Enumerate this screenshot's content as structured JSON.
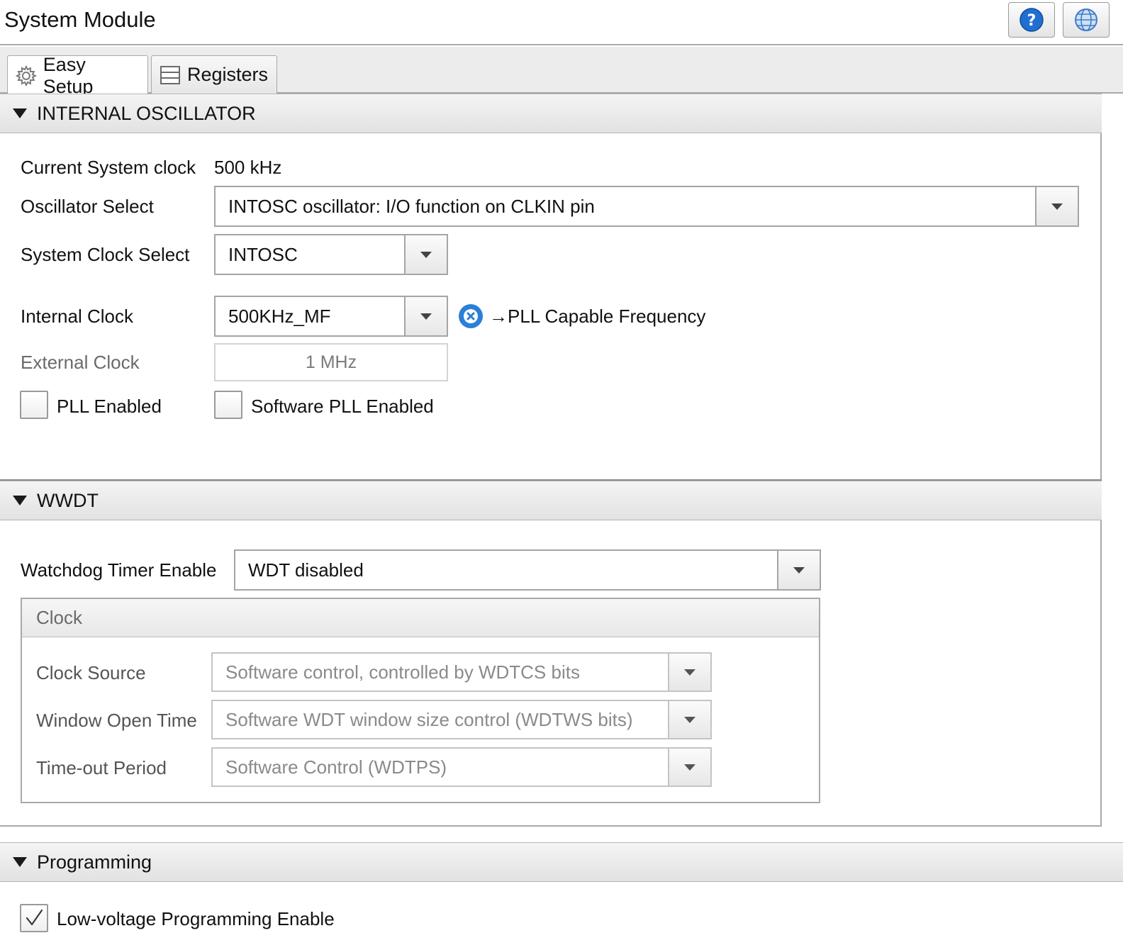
{
  "window": {
    "title": "System Module",
    "help_icon": "question-mark-icon",
    "globe_icon": "globe-icon"
  },
  "tabs": [
    {
      "label": "Easy Setup",
      "icon": "gear-icon",
      "active": true
    },
    {
      "label": "Registers",
      "icon": "registers-icon",
      "active": false
    }
  ],
  "internal_oscillator": {
    "title": "INTERNAL OSCILLATOR",
    "current_clock_label": "Current System clock",
    "current_clock_value": "500 kHz",
    "oscillator_select_label": "Oscillator Select",
    "oscillator_select_value": "INTOSC oscillator: I/O function on CLKIN pin",
    "system_clock_select_label": "System Clock Select",
    "system_clock_select_value": "INTOSC",
    "internal_clock_label": "Internal Clock",
    "internal_clock_value": "500KHz_MF",
    "pll_capable_text": "→PLL Capable Frequency",
    "status_color": "#2b7fd6",
    "external_clock_label": "External Clock",
    "external_clock_value": "1 MHz",
    "pll_enabled_label": "PLL Enabled",
    "pll_enabled_checked": false,
    "software_pll_label": "Software PLL Enabled",
    "software_pll_checked": false
  },
  "wwdt": {
    "title": "WWDT",
    "watchdog_enable_label": "Watchdog Timer Enable",
    "watchdog_enable_value": "WDT disabled",
    "clock_group": {
      "title": "Clock",
      "clock_source_label": "Clock Source",
      "clock_source_value": "Software control, controlled by WDTCS bits",
      "window_open_label": "Window Open Time",
      "window_open_value": "Software WDT window size control (WDTWS bits)",
      "timeout_label": "Time-out Period",
      "timeout_value": "Software Control (WDTPS)"
    }
  },
  "programming": {
    "title": "Programming",
    "lvp_label": "Low-voltage Programming Enable",
    "lvp_checked": true
  }
}
